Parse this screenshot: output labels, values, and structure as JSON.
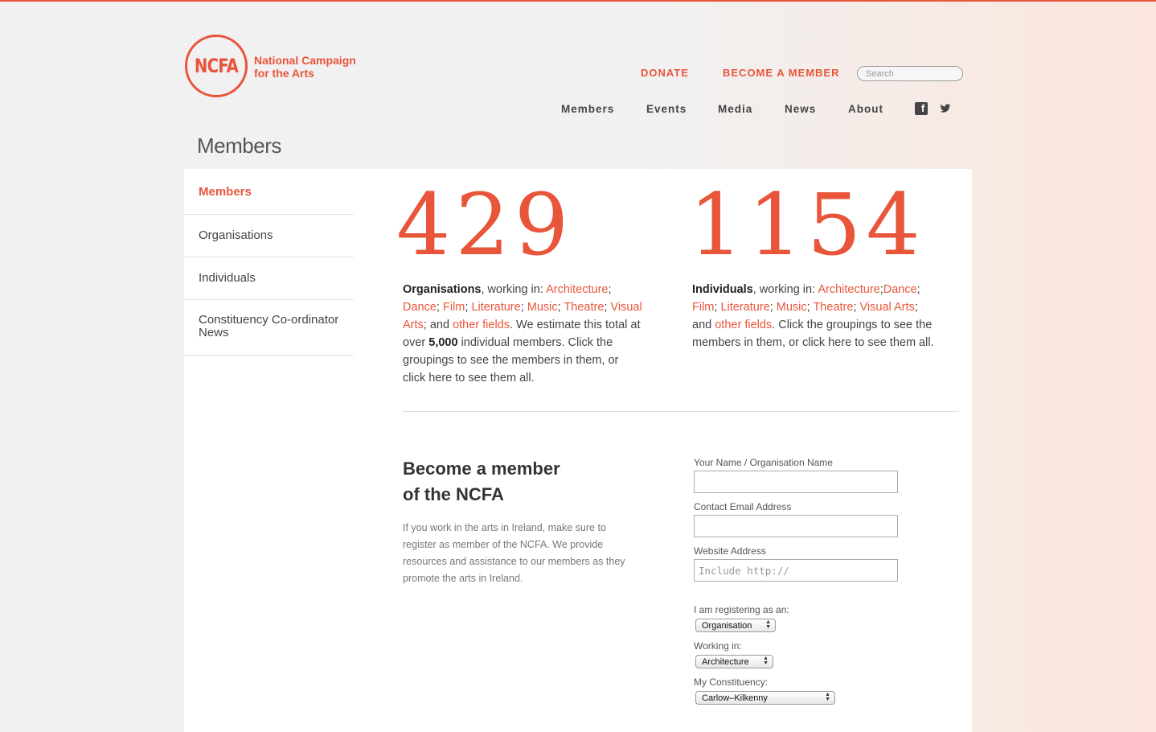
{
  "brand": {
    "logo_mark": "NCFA",
    "name_line1": "National Campaign",
    "name_line2": "for the Arts",
    "accent_color": "#e8553a"
  },
  "header": {
    "donate": "DONATE",
    "become_member": "BECOME A MEMBER",
    "search_placeholder": "Search"
  },
  "nav": {
    "items": [
      "Members",
      "Events",
      "Media",
      "News",
      "About"
    ],
    "social": [
      "facebook-icon",
      "twitter-icon"
    ]
  },
  "page": {
    "title": "Members"
  },
  "sidebar": {
    "items": [
      {
        "label": "Members",
        "active": true
      },
      {
        "label": "Organisations",
        "active": false
      },
      {
        "label": "Individuals",
        "active": false
      },
      {
        "label": "Constituency Co-ordinator News",
        "active": false
      }
    ]
  },
  "stats": {
    "organisations": {
      "count": "429",
      "label": "Organisations",
      "working_in": ", working in: ",
      "fields": [
        "Architecture",
        "Dance",
        "Film",
        "Literature",
        "Music",
        "Theatre",
        "Visual Arts"
      ],
      "and": "; and ",
      "other_fields": "other fields",
      "estimate_pre": ". We estimate this total at over ",
      "estimate_num": "5,000",
      "estimate_post": " individual members. Click the groupings to see the members in them, or click here to see them all."
    },
    "individuals": {
      "count": "1154",
      "label": "Individuals",
      "working_in": ", working in: ",
      "fields": [
        "Architecture",
        "Dance",
        "Film",
        "Literature",
        "Music",
        "Theatre",
        "Visual Arts"
      ],
      "and": ";\nand ",
      "other_fields": "other fields",
      "tail": ". Click the groupings to see the members in them, or click here to see them all."
    }
  },
  "become": {
    "title_line1": "Become a member",
    "title_line2": "of the NCFA",
    "description": "If you work in the arts in Ireland, make sure to register as member of the NCFA. We provide resources and assistance to our members as they promote the arts in Ireland."
  },
  "form": {
    "name_label": "Your Name / Organisation Name",
    "name_value": "",
    "email_label": "Contact Email Address",
    "email_value": "",
    "website_label": "Website Address",
    "website_placeholder": "Include http://",
    "registering_label": "I am registering as an:",
    "registering_value": "Organisation",
    "working_label": "Working in:",
    "working_value": "Architecture",
    "constituency_label": "My Constituency:",
    "constituency_value": "Carlow–Kilkenny"
  }
}
